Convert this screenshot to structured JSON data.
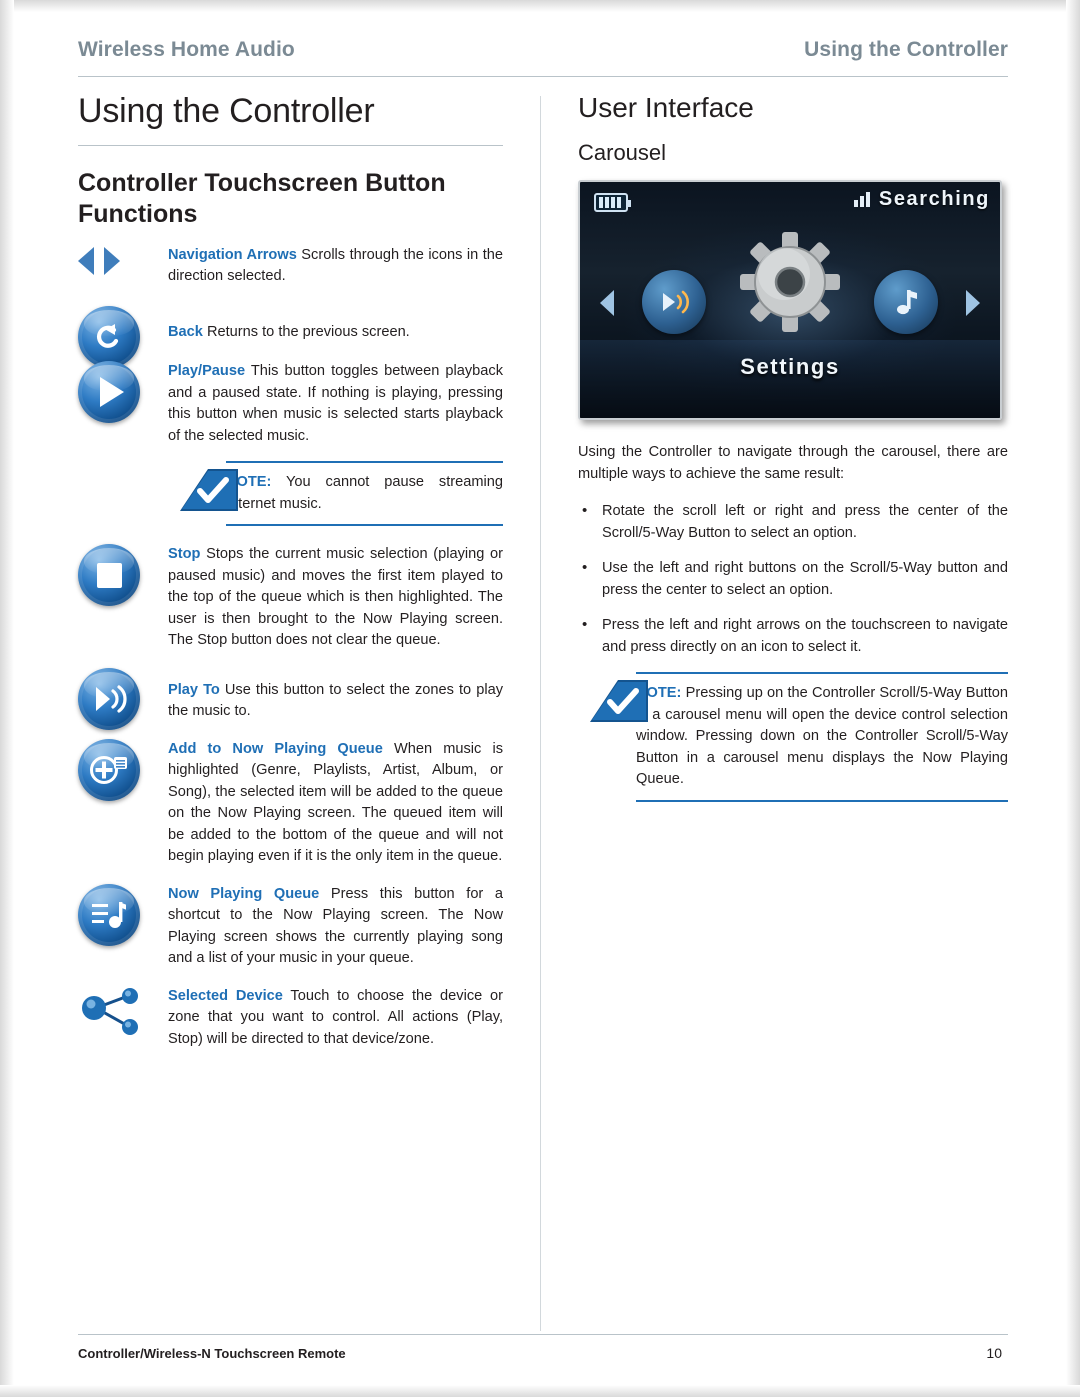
{
  "header": {
    "left": "Wireless Home Audio",
    "right": "Using the Controller"
  },
  "left_column": {
    "page_title": "Using the Controller",
    "section_title": "Controller Touchscreen Button Functions",
    "entries": [
      {
        "icon": "navigation-arrows-icon",
        "lead": "Navigation Arrows",
        "text": " Scrolls through the icons in the direction selected."
      },
      {
        "icon": "back-button-icon",
        "lead": "Back",
        "text": " Returns to the previous screen."
      },
      {
        "icon": "play-pause-button-icon",
        "lead": "Play/Pause",
        "text": " This button toggles between playback and a paused state. If nothing is playing, pressing this button when music is selected starts playback of the selected music."
      },
      {
        "icon": "stop-button-icon",
        "lead": "Stop",
        "text": " Stops the current music selection (playing or paused music) and moves the first item played to the top of the queue which is then highlighted. The user is then brought to the Now Playing screen. The Stop button does not clear the queue."
      },
      {
        "icon": "play-to-button-icon",
        "lead": "Play To",
        "text": " Use this button to select the zones to play the music to."
      },
      {
        "icon": "add-to-now-playing-queue-icon",
        "lead": "Add to Now Playing Queue",
        "text": " When music is highlighted (Genre, Playlists, Artist, Album, or Song), the selected item will be added to the queue on the Now Playing screen. The queued item will be added to the bottom of the queue and will not begin playing even if it is the only item in the queue."
      },
      {
        "icon": "now-playing-queue-icon",
        "lead": "Now Playing Queue",
        "text": " Press this button for a shortcut to the Now Playing screen. The Now Playing screen shows the currently playing song and a list of your music in your queue."
      },
      {
        "icon": "selected-device-icon",
        "lead": "Selected Device",
        "text": " Touch to choose the device or zone that you want to control. All actions (Play, Stop) will be directed to that device/zone."
      }
    ],
    "note": {
      "label": "NOTE:",
      "text": " You cannot pause streaming Internet music."
    }
  },
  "right_column": {
    "section_title": "User Interface",
    "subsection_title": "Carousel",
    "carousel_screen": {
      "status_text": "Searching",
      "battery_icon": "battery-icon",
      "signal_icon": "signal-strength-icon",
      "center_label": "Settings",
      "left_icon": "play-music-icon",
      "right_icon": "music-note-icon",
      "center_icon": "gear-icon",
      "left_arrow": "chevron-left-icon",
      "right_arrow": "chevron-right-icon"
    },
    "intro": "Using the Controller to navigate through the carousel, there are multiple ways to achieve the same result:",
    "bullets": [
      "Rotate the scroll left or right and press the center of the Scroll/5-Way Button to select an option.",
      "Use the left and right buttons on the Scroll/5-Way button and press the center to select an option.",
      "Press the left and right arrows on the touchscreen to navigate and press directly on an icon to select it."
    ],
    "note": {
      "label": "NOTE:",
      "text": " Pressing up on the Controller Scroll/5-Way Button in a carousel menu will open the device control selection window. Pressing down on the Controller Scroll/5-Way Button in a carousel menu displays the Now Playing Queue."
    }
  },
  "footer": {
    "left": "Controller/Wireless-N Touchscreen Remote",
    "page_number": "10"
  },
  "colors": {
    "accent_blue": "#1f6fb5",
    "header_grey": "#7b8a94",
    "rule": "#b9c3c9"
  }
}
